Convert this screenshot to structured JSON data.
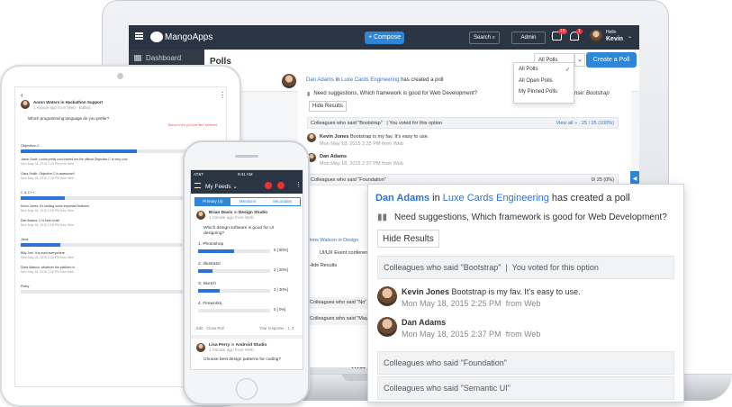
{
  "app": {
    "brand": "MangoApps",
    "compose": "+ Compose",
    "search": "Search",
    "admin": "Admin",
    "hello": "Hello",
    "user": "Kevin",
    "badge1": "10",
    "badge2": "1"
  },
  "sidebar": {
    "dashboard": "Dashboard"
  },
  "polls": {
    "title": "Polls",
    "filter": "All Polls",
    "create": "Create a Poll",
    "menu": [
      "All Polls",
      "All Open Polls",
      "My Pinned Polls"
    ],
    "author": "Dan Adams",
    "in": "in",
    "group": "Luxe Cards Engineering",
    "created": "has created a poll",
    "question": "Need suggestions, Which framework is good for Web Development?",
    "response": "response: Bootstrap",
    "hide": "Hide Results",
    "said_bootstrap": "Colleagues who said \"Bootstrap\"",
    "voted": "You voted for this option",
    "view_all": "View all » · 25 / 25 (100%)",
    "c1_name": "Kevin Jones",
    "c1_text": "Bootstrap is my fav. It's easy to use.",
    "c1_time": "Mon May 18, 2015 2:25 PM",
    "from_web": "from Web",
    "c2_name": "Dan Adams",
    "c2_time": "Mon May 18, 2015 2:37 PM",
    "zero": "0/ 25 (0%)",
    "foundation": "Colleagues who said \"Foundation\"",
    "watson": "Drew Watson",
    "in_design": "in Design",
    "uiux": "UI/UX Event conference",
    "said_no": "Colleagues who said \"No\"",
    "said_maybe": "Colleagues who said \"Maybe\"",
    "said_semantic": "Colleagues who said \"Semantic UI\"",
    "laptop_label": "Ma"
  },
  "tablet": {
    "poster": "Aaron Waters",
    "poster_in": "in Hackathon Support",
    "meta": "1 minute ago from Web · Edited",
    "question": "Which programming language do you prefer?",
    "warn": "Below to the poll just like I believed",
    "opt1": "Objective-C",
    "opt2": "C & C++",
    "opt3": "Java",
    "opt4": "Ruby",
    "c1": "Jason Scott: Looks pretty cool indeed but the official Objective-C is very cool",
    "c2": "Clara Smith: Objective-C is awesome!!",
    "c3": "Kevin Jones: It's lacking some important features",
    "c4": "Dan Adams: C is best of all!",
    "c5": "Billy Joel: It is used everywhere",
    "c6": "Drew Watson: whatever the platform is",
    "t": "Mon May 18, 2015 2:18 PM from Web"
  },
  "phone": {
    "carrier": "AT&T",
    "time": "9:41 AM",
    "feeds": "My Feeds",
    "tabs": [
      "Primary (4)",
      "Mentions",
      "Secondary"
    ],
    "poster": "Brian Davis",
    "in": "in",
    "group": "Design Studio",
    "meta": "1 minute ago from Web",
    "question": "Which design software is good for UI designing?",
    "options": [
      {
        "label": "1. Photoshop",
        "pct": "5 [ 50%]",
        "value": 50
      },
      {
        "label": "2. Illustrator",
        "pct": "2 [ 20%]",
        "value": 20
      },
      {
        "label": "3. Sketch",
        "pct": "3 [ 30%]",
        "value": 30
      },
      {
        "label": "4. Fireworks",
        "pct": "0 [ 0%]",
        "value": 0
      }
    ],
    "edit": "Edit · Close Poll",
    "resp": "Your response : 1, 3",
    "p2": "Lisa Perry",
    "p2group": "Android Studio",
    "p2meta": "1 minute ago from Web",
    "p2q": "Choose best design patterns for coding?"
  },
  "colors": {
    "accent": "#2d86d6",
    "dark": "#2a3443"
  }
}
